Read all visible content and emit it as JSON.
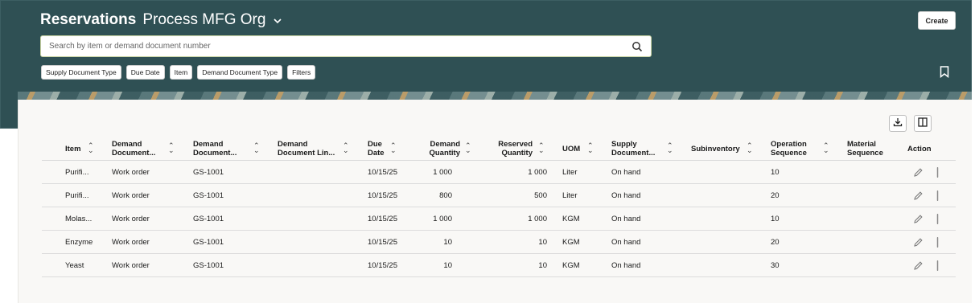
{
  "header": {
    "title": "Reservations",
    "org": "Process MFG Org",
    "create_label": "Create",
    "search_placeholder": "Search by item or demand document number",
    "filters": [
      "Supply Document Type",
      "Due Date",
      "Item",
      "Demand Document Type",
      "Filters"
    ]
  },
  "table": {
    "columns": [
      {
        "l1": "Item",
        "l2": ""
      },
      {
        "l1": "Demand",
        "l2": "Document..."
      },
      {
        "l1": "Demand",
        "l2": "Document..."
      },
      {
        "l1": "Demand",
        "l2": "Document Lin..."
      },
      {
        "l1": "Due",
        "l2": "Date"
      },
      {
        "l1": "Demand",
        "l2": "Quantity"
      },
      {
        "l1": "Reserved",
        "l2": "Quantity"
      },
      {
        "l1": "UOM",
        "l2": ""
      },
      {
        "l1": "Supply",
        "l2": "Document..."
      },
      {
        "l1": "Subinventory",
        "l2": ""
      },
      {
        "l1": "Operation",
        "l2": "Sequence"
      },
      {
        "l1": "Material",
        "l2": "Sequence"
      },
      {
        "l1": "Action",
        "l2": ""
      }
    ],
    "rows": [
      {
        "item": "Purifi...",
        "demand_doc_type": "Work order",
        "demand_doc": "GS-1001",
        "demand_doc_line": "",
        "due_date": "10/15/25",
        "demand_qty": "1 000",
        "reserved_qty": "1 000",
        "uom": "Liter",
        "supply_doc": "On hand",
        "subinventory": "",
        "op_seq": "10",
        "mat_seq": ""
      },
      {
        "item": "Purifi...",
        "demand_doc_type": "Work order",
        "demand_doc": "GS-1001",
        "demand_doc_line": "",
        "due_date": "10/15/25",
        "demand_qty": "800",
        "reserved_qty": "500",
        "uom": "Liter",
        "supply_doc": "On hand",
        "subinventory": "",
        "op_seq": "20",
        "mat_seq": ""
      },
      {
        "item": "Molas...",
        "demand_doc_type": "Work order",
        "demand_doc": "GS-1001",
        "demand_doc_line": "",
        "due_date": "10/15/25",
        "demand_qty": "1 000",
        "reserved_qty": "1 000",
        "uom": "KGM",
        "supply_doc": "On hand",
        "subinventory": "",
        "op_seq": "10",
        "mat_seq": ""
      },
      {
        "item": "Enzyme",
        "demand_doc_type": "Work order",
        "demand_doc": "GS-1001",
        "demand_doc_line": "",
        "due_date": "10/15/25",
        "demand_qty": "10",
        "reserved_qty": "10",
        "uom": "KGM",
        "supply_doc": "On hand",
        "subinventory": "",
        "op_seq": "20",
        "mat_seq": ""
      },
      {
        "item": "Yeast",
        "demand_doc_type": "Work order",
        "demand_doc": "GS-1001",
        "demand_doc_line": "",
        "due_date": "10/15/25",
        "demand_qty": "10",
        "reserved_qty": "10",
        "uom": "KGM",
        "supply_doc": "On hand",
        "subinventory": "",
        "op_seq": "30",
        "mat_seq": ""
      }
    ]
  },
  "icons": {
    "search": "search-icon",
    "bookmark": "bookmark-icon",
    "download": "download-icon",
    "columns": "columns-icon",
    "edit": "pencil-icon",
    "more": "kebab-icon",
    "sort": "sort-icon",
    "dropdown": "chevron-down-icon"
  },
  "colors": {
    "header_bg": "#2f5054",
    "card_bg": "#f9f8f6"
  }
}
